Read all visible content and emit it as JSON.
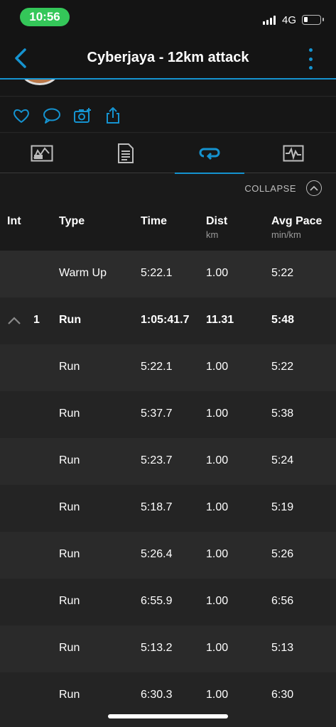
{
  "status": {
    "time": "10:56",
    "network": "4G"
  },
  "nav": {
    "title": "Cyberjaya - 12km attack"
  },
  "actions": [
    "heart-icon",
    "comment-icon",
    "camera-icon",
    "share-icon"
  ],
  "tabs": [
    "stats-tab",
    "details-tab",
    "laps-tab",
    "chart-tab"
  ],
  "collapse": {
    "label": "COLLAPSE"
  },
  "table": {
    "headers": {
      "int": "Int",
      "type": "Type",
      "time": "Time",
      "dist": "Dist",
      "dist_unit": "km",
      "pace": "Avg Pace",
      "pace_unit": "min/km"
    },
    "rows": [
      {
        "int": "",
        "type": "Warm Up",
        "time": "5:22.1",
        "dist": "1.00",
        "pace": "5:22"
      },
      {
        "int": "1",
        "type": "Run",
        "time": "1:05:41.7",
        "dist": "11.31",
        "pace": "5:48"
      },
      {
        "int": "",
        "type": "Run",
        "time": "5:22.1",
        "dist": "1.00",
        "pace": "5:22"
      },
      {
        "int": "",
        "type": "Run",
        "time": "5:37.7",
        "dist": "1.00",
        "pace": "5:38"
      },
      {
        "int": "",
        "type": "Run",
        "time": "5:23.7",
        "dist": "1.00",
        "pace": "5:24"
      },
      {
        "int": "",
        "type": "Run",
        "time": "5:18.7",
        "dist": "1.00",
        "pace": "5:19"
      },
      {
        "int": "",
        "type": "Run",
        "time": "5:26.4",
        "dist": "1.00",
        "pace": "5:26"
      },
      {
        "int": "",
        "type": "Run",
        "time": "6:55.9",
        "dist": "1.00",
        "pace": "6:56"
      },
      {
        "int": "",
        "type": "Run",
        "time": "5:13.2",
        "dist": "1.00",
        "pace": "5:13"
      },
      {
        "int": "",
        "type": "Run",
        "time": "6:30.3",
        "dist": "1.00",
        "pace": "6:30"
      }
    ]
  },
  "colors": {
    "accent": "#1593d0",
    "time_pill": "#34c759"
  }
}
